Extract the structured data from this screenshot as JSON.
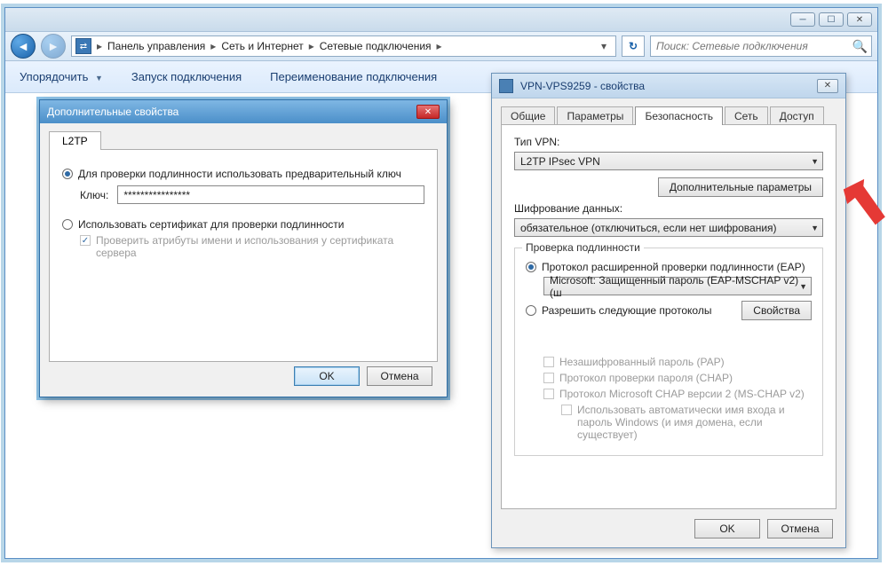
{
  "explorer": {
    "breadcrumb": [
      "Панель управления",
      "Сеть и Интернет",
      "Сетевые подключения"
    ],
    "search_placeholder": "Поиск: Сетевые подключения",
    "toolbar": {
      "organize": "Упорядочить",
      "start_conn": "Запуск подключения",
      "rename_conn": "Переименование подключения"
    }
  },
  "props_dialog": {
    "title": "VPN-VPS9259 - свойства",
    "tabs": {
      "general": "Общие",
      "options": "Параметры",
      "security": "Безопасность",
      "network": "Сеть",
      "access": "Доступ"
    },
    "vpn_type_label": "Тип VPN:",
    "vpn_type_value": "L2TP IPsec VPN",
    "advanced_button": "Дополнительные параметры",
    "encryption_label": "Шифрование данных:",
    "encryption_value": "обязательное (отключиться, если нет шифрования)",
    "auth_group": "Проверка подлинности",
    "eap_radio": "Протокол расширенной проверки подлинности (EAP)",
    "eap_value": "Microsoft: Защищенный пароль (EAP-MSCHAP v2) (ш",
    "allow_radio": "Разрешить следующие протоколы",
    "props_button": "Свойства",
    "allow": {
      "pap": "Незашифрованный пароль (PAP)",
      "chap": "Протокол проверки пароля (CHAP)",
      "mschap": "Протокол Microsoft CHAP версии 2 (MS-CHAP v2)",
      "auto": "Использовать автоматически имя входа и пароль Windows (и имя домена, если существует)"
    },
    "ok": "OK",
    "cancel": "Отмена"
  },
  "adv_dialog": {
    "title": "Дополнительные свойства",
    "tab": "L2TP",
    "psk_radio": "Для проверки подлинности использовать предварительный ключ",
    "key_label": "Ключ:",
    "key_value": "****************",
    "cert_radio": "Использовать сертификат для проверки подлинности",
    "verify_check": "Проверить атрибуты имени и использования у сертификата сервера",
    "ok": "OK",
    "cancel": "Отмена"
  }
}
